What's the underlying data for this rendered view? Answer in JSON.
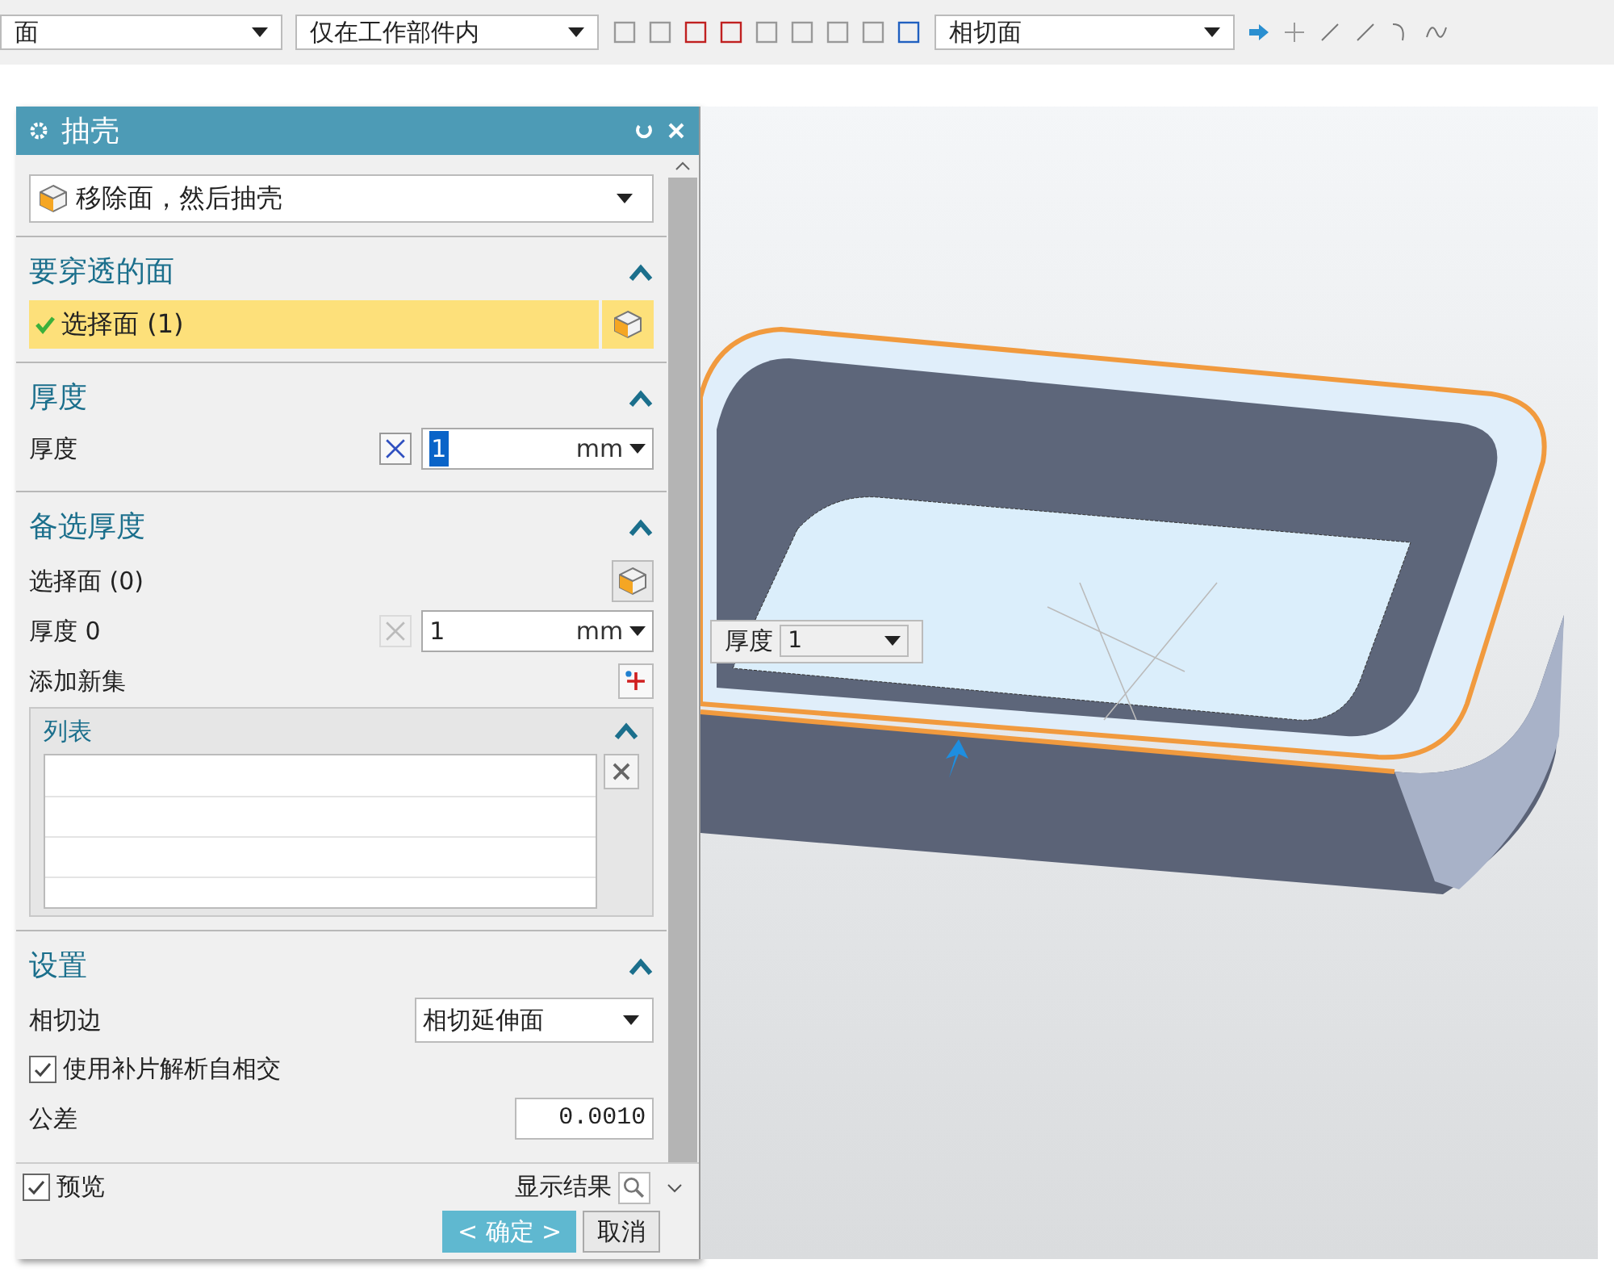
{
  "toolbar": {
    "filter_dropdown": "面",
    "scope_dropdown": "仅在工作部件内",
    "face_rule_dropdown": "相切面"
  },
  "dialog": {
    "title": "抽壳",
    "type_dropdown": "移除面，然后抽壳",
    "faces_to_pierce": {
      "title": "要穿透的面",
      "expanded": true,
      "select_label": "选择面 (1)",
      "active": true,
      "done": true
    },
    "thickness": {
      "title": "厚度",
      "expanded": true,
      "label": "厚度",
      "value": "1",
      "unit": "mm"
    },
    "alternate_thickness": {
      "title": "备选厚度",
      "expanded": true,
      "select_label": "选择面 (0)",
      "thickness_label": "厚度 0",
      "value": "1",
      "unit": "mm",
      "add_set_label": "添加新集",
      "list": {
        "title": "列表",
        "expanded": true
      }
    },
    "settings": {
      "title": "设置",
      "expanded": true,
      "tangent_edge_label": "相切边",
      "tangent_edge_value": "相切延伸面",
      "patch_checkbox": {
        "label": "使用补片解析自相交",
        "checked": true
      },
      "tolerance_label": "公差",
      "tolerance_value": "0.0010"
    },
    "preview": {
      "label": "预览",
      "checked": true
    },
    "show_result": "显示结果",
    "buttons": [
      {
        "label": "< 确定 >",
        "kind": "primary"
      },
      {
        "label": "取消",
        "kind": "secondary"
      }
    ]
  },
  "viewport": {
    "thickness_tag": {
      "label": "厚度",
      "value": "1"
    }
  }
}
